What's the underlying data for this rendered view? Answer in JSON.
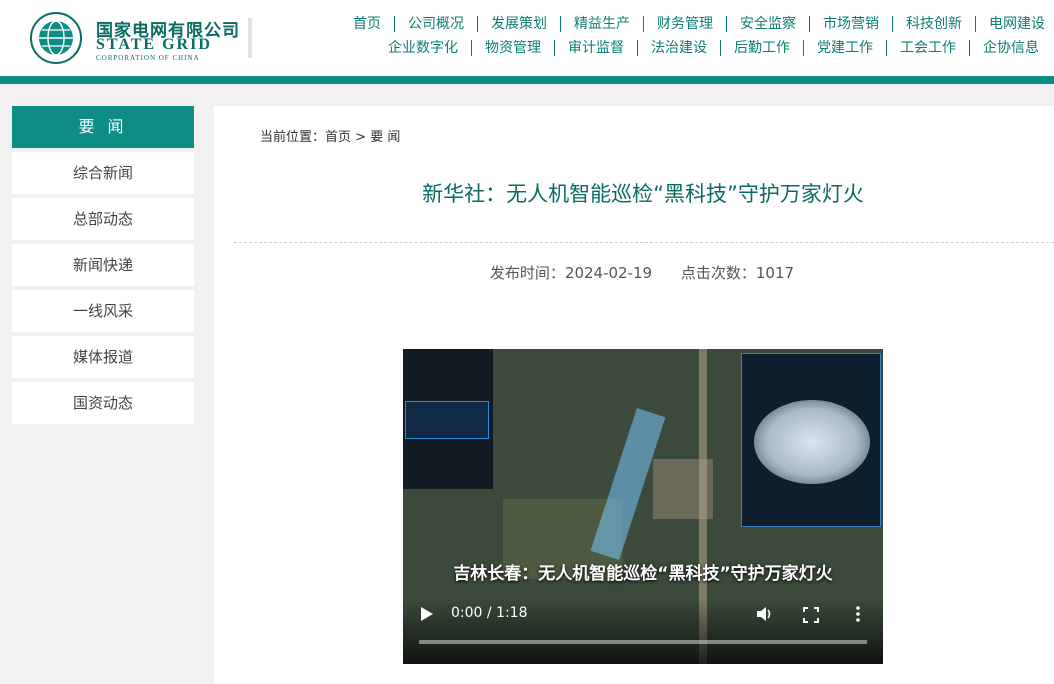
{
  "header": {
    "logo_cn": "国家电网有限公司",
    "logo_en": "STATE GRID",
    "logo_en_sub": "CORPORATION OF CHINA",
    "nav_row1": [
      "首页",
      "公司概况",
      "发展策划",
      "精益生产",
      "财务管理",
      "安全监察",
      "市场营销",
      "科技创新",
      "电网建设"
    ],
    "nav_row2": [
      "企业数字化",
      "物资管理",
      "审计监督",
      "法治建设",
      "后勤工作",
      "党建工作",
      "工会工作",
      "企协信息"
    ]
  },
  "sidebar": {
    "heading": "要 闻",
    "items": [
      "综合新闻",
      "总部动态",
      "新闻快递",
      "一线风采",
      "媒体报道",
      "国资动态"
    ]
  },
  "breadcrumb": {
    "prefix": "当前位置：",
    "home": "首页",
    "sep": " > ",
    "current": "要 闻"
  },
  "article": {
    "title": "新华社：无人机智能巡检“黑科技”守护万家灯火",
    "publish_label": "发布时间：2024-02-19",
    "clicks_label": "点击次数：1017"
  },
  "video": {
    "caption": "吉林长春：无人机智能巡检“黑科技”守护万家灯火",
    "time": "0:00 / 1:18",
    "progress": 0
  },
  "colors": {
    "brand": "#0e8d84",
    "brand_dark": "#0a6b63"
  }
}
